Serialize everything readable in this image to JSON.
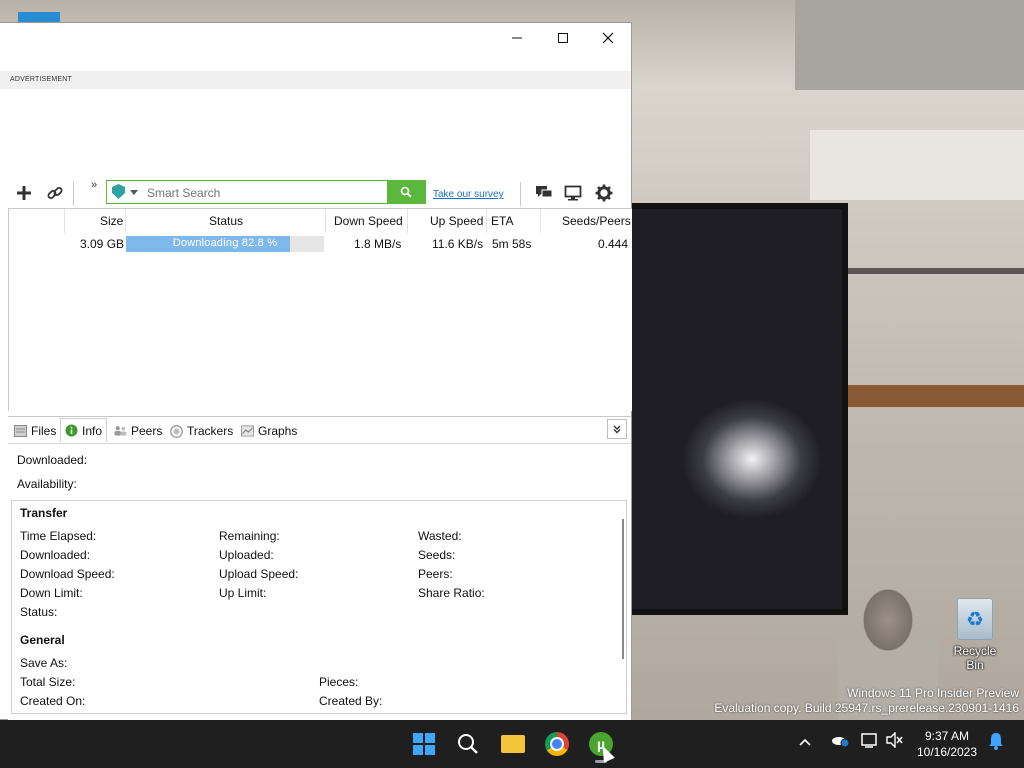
{
  "desktop": {
    "recycle_bin_label": "Recycle Bin",
    "watermark_line1": "Windows 11 Pro Insider Preview",
    "watermark_line2": "Evaluation copy. Build 25947.rs_prerelease.230901-1416"
  },
  "window": {
    "controls": {
      "minimize": "—",
      "maximize": "☐",
      "close": "✕"
    },
    "ad_label": "ADVERTISEMENT"
  },
  "toolbar": {
    "add_icon": "plus-icon",
    "link_icon": "link-icon",
    "overflow": "»",
    "search_placeholder": "Smart Search",
    "search_value": "",
    "survey_link": "Take our survey",
    "chat_icon": "chat-icon",
    "remote_icon": "monitor-icon",
    "settings_icon": "gear-icon"
  },
  "torrent_list": {
    "columns": [
      "Size",
      "Status",
      "Down Speed",
      "Up Speed",
      "ETA",
      "Seeds/Peers"
    ],
    "rows": [
      {
        "size": "3.09 GB",
        "status": "Downloading 82.8 %",
        "progress": 0.828,
        "down_speed": "1.8 MB/s",
        "up_speed": "11.6 KB/s",
        "eta": "5m 58s",
        "seeds_peers": "0.444"
      }
    ]
  },
  "tabs": [
    {
      "label": "Files",
      "icon": "files-icon"
    },
    {
      "label": "Info",
      "icon": "info-icon",
      "active": true
    },
    {
      "label": "Peers",
      "icon": "peers-icon"
    },
    {
      "label": "Trackers",
      "icon": "trackers-icon"
    },
    {
      "label": "Graphs",
      "icon": "graphs-icon"
    }
  ],
  "info": {
    "downloaded": "Downloaded:",
    "availability": "Availability:",
    "transfer_title": "Transfer",
    "transfer": {
      "time_elapsed": "Time Elapsed:",
      "remaining": "Remaining:",
      "wasted": "Wasted:",
      "downloaded": "Downloaded:",
      "uploaded": "Uploaded:",
      "seeds": "Seeds:",
      "download_speed": "Download Speed:",
      "upload_speed": "Upload Speed:",
      "peers": "Peers:",
      "down_limit": "Down Limit:",
      "up_limit": "Up Limit:",
      "share_ratio": "Share Ratio:",
      "status": "Status:"
    },
    "general_title": "General",
    "general": {
      "save_as": "Save As:",
      "total_size": "Total Size:",
      "pieces": "Pieces:",
      "created_on": "Created On:",
      "created_by": "Created By:"
    }
  },
  "taskbar": {
    "apps": [
      "start-icon",
      "search-icon",
      "file-explorer-icon",
      "chrome-icon",
      "utorrent-icon"
    ],
    "tray_chevron": "^",
    "time": "9:37 AM",
    "date": "10/16/2023"
  }
}
